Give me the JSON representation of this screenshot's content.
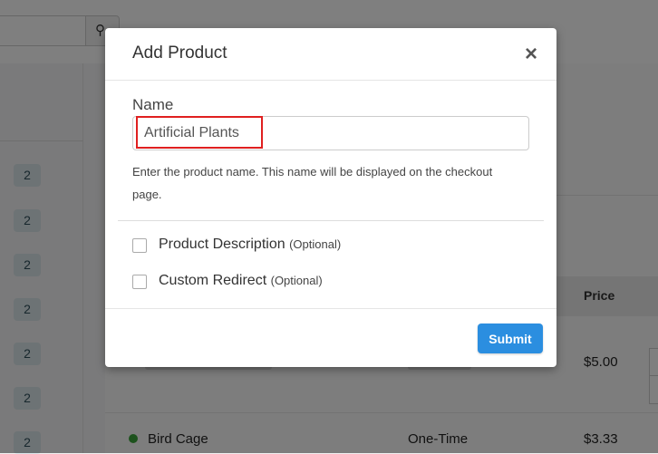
{
  "background": {
    "search_button_icon": "search-icon",
    "badges": [
      "2",
      "2",
      "2",
      "2",
      "2",
      "2",
      "2"
    ],
    "table_header_price": "Price",
    "rows": [
      {
        "price": "$5.00"
      },
      {
        "name": "Bird Cage",
        "type": "One-Time",
        "price": "$3.33",
        "status_color": "#3aa53a"
      }
    ]
  },
  "modal": {
    "title": "Add Product",
    "close_label": "×",
    "name_label": "Name",
    "name_value": "Artificial Plants",
    "help_text": "Enter the product name. This name will be displayed on the checkout page.",
    "options": [
      {
        "label": "Product Description",
        "optional": "(Optional)",
        "checked": false
      },
      {
        "label": "Custom Redirect",
        "optional": "(Optional)",
        "checked": false
      }
    ],
    "submit_label": "Submit",
    "accent_color": "#2b8ee0",
    "highlight_color": "#e02020"
  }
}
